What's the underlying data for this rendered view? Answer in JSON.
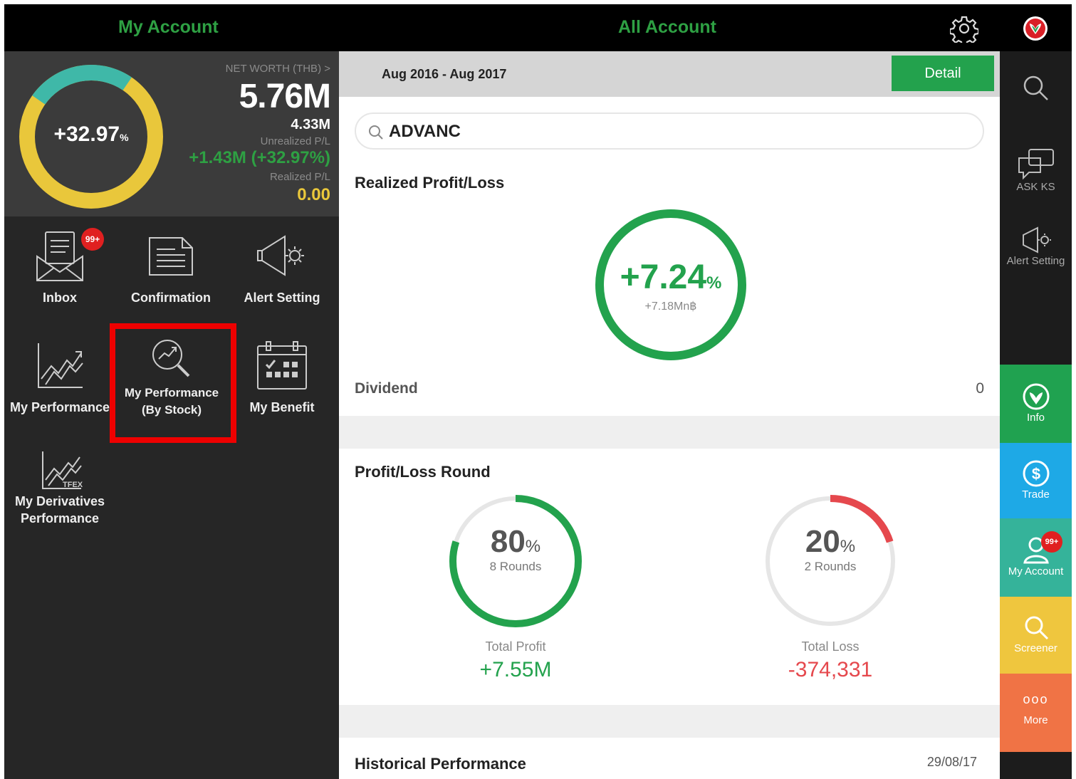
{
  "header": {
    "left_title": "My Account",
    "center_title": "All Account",
    "settings_icon": "gear-icon",
    "logo_icon": "kasikorn-logo-icon"
  },
  "summary": {
    "donut_value": "+32.97",
    "donut_unit": "%",
    "net_worth_label": "NET WORTH (THB) >",
    "net_worth_value": "5.76M",
    "cost_value": "4.33M",
    "unrealized_label": "Unrealized P/L",
    "unrealized_value": "+1.43M (+32.97%)",
    "realized_label": "Realized P/L",
    "realized_value": "0.00",
    "colors": {
      "gain": "#2ea043",
      "yellow": "#e9c73b",
      "teal": "#3fb8a8"
    }
  },
  "menu": {
    "inbox": "Inbox",
    "inbox_badge": "99+",
    "confirmation": "Confirmation",
    "alert_setting": "Alert Setting",
    "my_performance": "My Performance",
    "my_performance_stock_1": "My Performance",
    "my_performance_stock_2": "(By Stock)",
    "my_benefit": "My Benefit",
    "derivatives_1": "My Derivatives",
    "derivatives_2": "Performance",
    "derivatives_icon_tag": "TFEX"
  },
  "main": {
    "date_range": "Aug 2016 - Aug 2017",
    "detail_label": "Detail",
    "search_value": "ADVANC",
    "realized_title": "Realized Profit/Loss",
    "realized_pct": "+7.24",
    "realized_unit": "%",
    "realized_amount": "+7.18Mn฿",
    "dividend_label": "Dividend",
    "dividend_value": "0",
    "round_title": "Profit/Loss Round",
    "win_pct": "80",
    "win_rounds": "8 Rounds",
    "win_fraction": 0.8,
    "loss_pct": "20",
    "loss_rounds": "2 Rounds",
    "loss_fraction": 0.2,
    "total_profit_label": "Total Profit",
    "total_profit_value": "+7.55M",
    "total_loss_label": "Total Loss",
    "total_loss_value": "-374,331",
    "historical_title": "Historical Performance",
    "historical_date": "29/08/17",
    "colors": {
      "green": "#23a24d",
      "red": "#e5484d"
    }
  },
  "sidebar": {
    "ask": "ASK KS",
    "alert": "Alert Setting",
    "info": "Info",
    "trade": "Trade",
    "account": "My Account",
    "account_badge": "99+",
    "screener": "Screener",
    "more_dots": "ooo",
    "more": "More",
    "colors": {
      "info": "#20a250",
      "trade": "#1ea9e6",
      "account": "#35b39a",
      "screener": "#efc63e",
      "more": "#f07345"
    }
  }
}
